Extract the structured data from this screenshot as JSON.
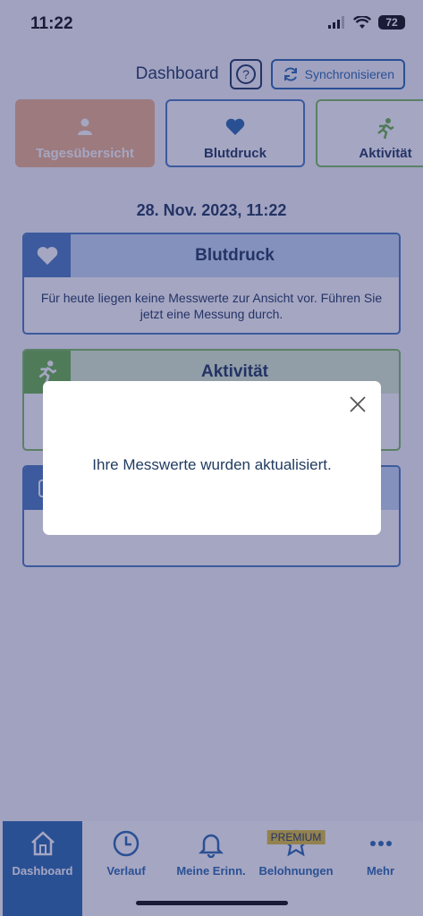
{
  "status_bar": {
    "time": "11:22",
    "battery": "72"
  },
  "header": {
    "title": "Dashboard",
    "help_label": "?",
    "sync_label": "Synchronisieren"
  },
  "categories": [
    {
      "label": "Tagesübersicht",
      "icon": "person-icon"
    },
    {
      "label": "Blutdruck",
      "icon": "heart-icon"
    },
    {
      "label": "Aktivität",
      "icon": "running-icon"
    }
  ],
  "date_label": "28. Nov. 2023, 11:22",
  "cards": {
    "blood_pressure": {
      "title": "Blutdruck",
      "text": "Für heute liegen keine Messwerte zur Ansicht vor. Führen Sie jetzt eine Messung durch."
    },
    "activity": {
      "title": "Aktivität"
    }
  },
  "modal": {
    "message": "Ihre Messwerte wurden aktualisiert.",
    "close_icon": "close-icon"
  },
  "tabbar": {
    "items": [
      {
        "label": "Dashboard",
        "icon": "home-icon"
      },
      {
        "label": "Verlauf",
        "icon": "clock-icon"
      },
      {
        "label": "Meine Erinn.",
        "icon": "bell-icon"
      },
      {
        "label": "Belohnungen",
        "icon": "star-icon",
        "badge": "PREMIUM"
      },
      {
        "label": "Mehr",
        "icon": "more-dots-icon"
      }
    ]
  },
  "colors": {
    "primary": "#2b6cb0",
    "accent_blue": "#4b7cc0",
    "accent_green": "#6db54a",
    "accent_orange": "#f0b48b",
    "premium": "#e1c23a",
    "overlay": "rgba(40,44,110,0.42)"
  }
}
